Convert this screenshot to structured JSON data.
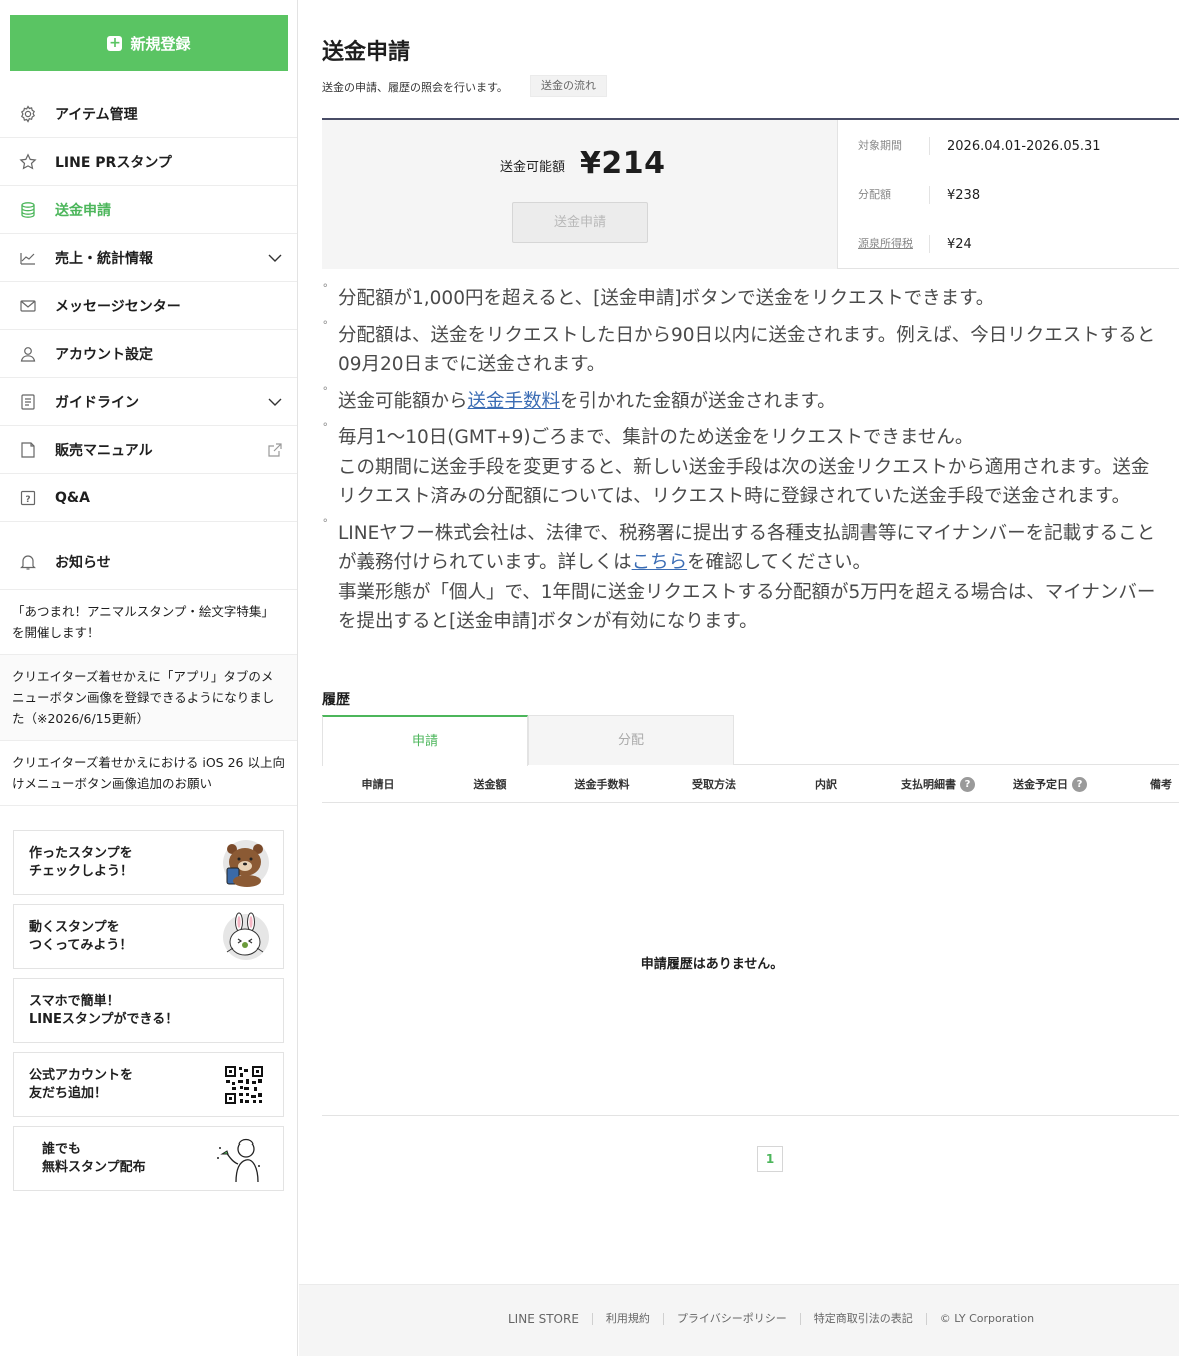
{
  "sidebar": {
    "new_register": "新規登録",
    "nav": [
      {
        "label": "アイテム管理",
        "icon": "gear-icon"
      },
      {
        "label": "LINE PRスタンプ",
        "icon": "star-icon"
      },
      {
        "label": "送金申請",
        "icon": "coins-icon",
        "active": true
      },
      {
        "label": "売上・統計情報",
        "icon": "chart-icon",
        "expand": true
      },
      {
        "label": "メッセージセンター",
        "icon": "mail-icon"
      },
      {
        "label": "アカウント設定",
        "icon": "user-icon"
      },
      {
        "label": "ガイドライン",
        "icon": "document-icon",
        "expand": true
      },
      {
        "label": "販売マニュアル",
        "icon": "book-icon",
        "external": true
      },
      {
        "label": "Q&A",
        "icon": "question-icon"
      }
    ],
    "notice": {
      "label": "お知らせ",
      "icon": "bell-icon"
    },
    "news": [
      "「あつまれ！アニマルスタンプ・絵文字特集」を開催します！",
      "クリエイターズ着せかえに「アプリ」タブのメニューボタン画像を登録できるようになりました（※2026/6/15更新）",
      "クリエイターズ着せかえにおける iOS 26 以上向けメニューボタン画像追加のお願い"
    ],
    "banners": [
      {
        "text": "作ったスタンプを\nチェックしよう！",
        "image": "brown-bear-icon"
      },
      {
        "text": "動くスタンプを\nつくってみよう！",
        "image": "cony-rabbit-icon"
      },
      {
        "text": "スマホで簡単！\nLINEスタンプができる！",
        "image": ""
      },
      {
        "text": "公式アカウントを\n友だち追加！",
        "image": "qr-code-icon"
      },
      {
        "text": "誰でも\n無料スタンプ配布",
        "image": "person-illustration-icon"
      }
    ]
  },
  "main": {
    "title": "送金申請",
    "description": "送金の申請、履歴の照会を行います。",
    "flow_button": "送金の流れ",
    "summary": {
      "available_label": "送金可能額",
      "available_amount": "¥214",
      "send_button": "送金申請",
      "rows": [
        {
          "label": "対象期間",
          "value": "2026.04.01-2026.05.31"
        },
        {
          "label": "分配額",
          "value": "¥238"
        },
        {
          "label": "源泉所得税",
          "value": "¥24"
        }
      ]
    },
    "notes": {
      "n1": "分配額が1,000円を超えると、[送金申請]ボタンで送金をリクエストできます。",
      "n2a": "分配額は、送金をリクエストした日から90日以内に送金されます。例えば、今日リクエストすると",
      "n2b": "09月20日までに送金されます。",
      "n3a": "送金可能額から",
      "n3link": "送金手数料",
      "n3b": "を引かれた金額が送金されます。",
      "n4a": "毎月1〜10日(GMT+9)ごろまで、集計のため送金をリクエストできません。",
      "n4b": "この期間に送金手段を変更すると、新しい送金手段は次の送金リクエストから適用されます。送金",
      "n4c": "リクエスト済みの分配額については、リクエスト時に登録されていた送金手段で送金されます。",
      "n5a": "LINEヤフー株式会社は、法律で、税務署に提出する各種支払調書等にマイナンバーを記載すること",
      "n5b": "が義務付けられています。詳しくは",
      "n5link": "こちら",
      "n5c": "を確認してください。",
      "n5d": "事業形態が「個人」で、1年間に送金リクエストする分配額が5万円を超える場合は、マイナンバー",
      "n5e": "を提出すると[送金申請]ボタンが有効になります。"
    },
    "history": {
      "title": "履歴",
      "tabs": [
        "申請",
        "分配"
      ],
      "columns": [
        "申請日",
        "送金額",
        "送金手数料",
        "受取方法",
        "内訳",
        "支払明細書",
        "送金予定日",
        "備考"
      ],
      "empty": "申請履歴はありません。",
      "page": "1"
    }
  },
  "footer": {
    "links": [
      "LINE STORE",
      "利用規約",
      "プライバシーポリシー",
      "特定商取引法の表記"
    ],
    "copyright": "© LY Corporation"
  },
  "colors": {
    "brand_green": "#5ac463",
    "active_green": "#4cb65b",
    "link_blue": "#3a6cb4",
    "summary_border": "#484c66"
  }
}
